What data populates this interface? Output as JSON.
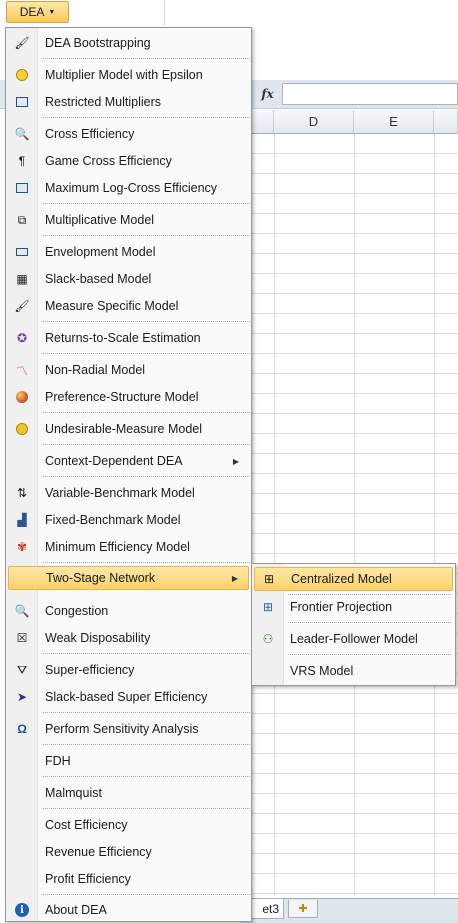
{
  "ribbon": {
    "dea_label": "DEA"
  },
  "formula_bar": {
    "fx_label": "fx"
  },
  "columns": [
    "D",
    "E"
  ],
  "sheet_tab": {
    "label": "et3"
  },
  "menu": {
    "items": [
      {
        "label": "DEA Bootstrapping",
        "icon": "bootstrap-icon"
      },
      {
        "label": "Multiplier Model with Epsilon",
        "icon": "smiley-icon"
      },
      {
        "label": "Restricted Multipliers",
        "icon": "table-icon"
      },
      {
        "label": "Cross Efficiency",
        "icon": "magnifier-icon"
      },
      {
        "label": "Game Cross Efficiency",
        "icon": "pilcrow-icon"
      },
      {
        "label": "Maximum Log-Cross Efficiency",
        "icon": "picture-icon"
      },
      {
        "label": "Multiplicative Model",
        "icon": "copy-icon"
      },
      {
        "label": "Envelopment Model",
        "icon": "envelope-icon"
      },
      {
        "label": "Slack-based Model",
        "icon": "grid-icon"
      },
      {
        "label": "Measure Specific Model",
        "icon": "ruler-icon"
      },
      {
        "label": "Returns-to-Scale Estimation",
        "icon": "star-icon"
      },
      {
        "label": "Non-Radial Model",
        "icon": "chart-line-icon"
      },
      {
        "label": "Preference-Structure Model",
        "icon": "ball-icon"
      },
      {
        "label": "Undesirable-Measure Model",
        "icon": "palette-icon"
      },
      {
        "label": "Context-Dependent DEA",
        "icon": ""
      },
      {
        "label": "Variable-Benchmark Model",
        "icon": "sort-icon"
      },
      {
        "label": "Fixed-Benchmark Model",
        "icon": "bar-chart-icon"
      },
      {
        "label": "Minimum Efficiency Model",
        "icon": "bug-icon"
      },
      {
        "label": "Two-Stage Network",
        "icon": ""
      },
      {
        "label": "Congestion",
        "icon": "search-icon"
      },
      {
        "label": "Weak Disposability",
        "icon": "cross-box-icon"
      },
      {
        "label": "Super-efficiency",
        "icon": "funnel-icon"
      },
      {
        "label": "Slack-based Super Efficiency",
        "icon": "pointer-icon"
      },
      {
        "label": "Perform Sensitivity Analysis",
        "icon": "omega-icon"
      },
      {
        "label": "FDH",
        "icon": ""
      },
      {
        "label": "Malmquist",
        "icon": ""
      },
      {
        "label": "Cost Efficiency",
        "icon": ""
      },
      {
        "label": "Revenue Efficiency",
        "icon": ""
      },
      {
        "label": "Profit Efficiency",
        "icon": ""
      },
      {
        "label": "About DEA",
        "icon": "info-icon"
      }
    ]
  },
  "submenu": {
    "items": [
      {
        "label": "Centralized Model",
        "icon": "network-icon"
      },
      {
        "label": "Frontier Projection",
        "icon": "network-icon"
      },
      {
        "label": "Leader-Follower Model",
        "icon": "people-icon"
      },
      {
        "label": "VRS Model",
        "icon": ""
      }
    ]
  }
}
